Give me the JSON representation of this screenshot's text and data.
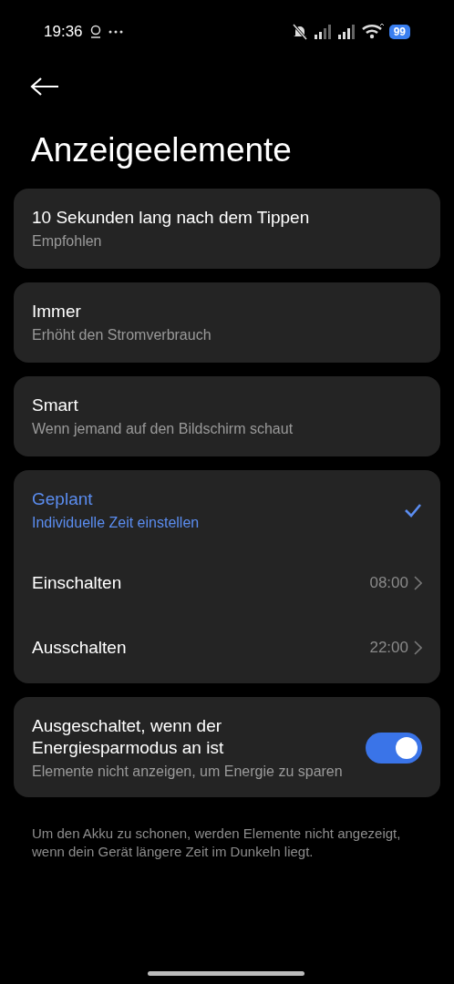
{
  "status_bar": {
    "time": "19:36",
    "battery": "99"
  },
  "title": "Anzeigeelemente",
  "options": [
    {
      "title": "10 Sekunden lang nach dem Tippen",
      "subtitle": "Empfohlen",
      "selected": false
    },
    {
      "title": "Immer",
      "subtitle": "Erhöht den Stromverbrauch",
      "selected": false
    },
    {
      "title": "Smart",
      "subtitle": "Wenn jemand auf den Bildschirm schaut",
      "selected": false
    },
    {
      "title": "Geplant",
      "subtitle": "Individuelle Zeit einstellen",
      "selected": true,
      "schedule": [
        {
          "label": "Einschalten",
          "value": "08:00"
        },
        {
          "label": "Ausschalten",
          "value": "22:00"
        }
      ]
    }
  ],
  "power_saving": {
    "title": "Ausgeschaltet, wenn der Energiesparmodus an ist",
    "subtitle": "Elemente nicht anzeigen, um Energie zu sparen",
    "on": true
  },
  "footnote": "Um den Akku zu schonen, werden Elemente nicht angezeigt, wenn dein Gerät längere Zeit im Dunkeln liegt."
}
